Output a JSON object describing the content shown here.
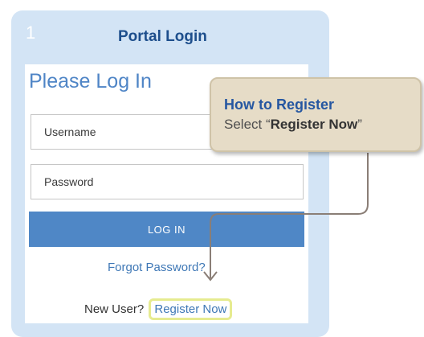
{
  "login_panel": {
    "step_number": "1",
    "title": "Portal Login",
    "heading": "Please Log In",
    "username_placeholder": "Username",
    "password_placeholder": "Password",
    "login_button_label": "LOG IN",
    "forgot_password_label": "Forgot Password?",
    "new_user_label": "New User?",
    "register_label": "Register Now"
  },
  "callout": {
    "title": "How to Register",
    "text_prefix": "Select “",
    "text_emphasis": "Register Now",
    "text_suffix": "”"
  },
  "colors": {
    "panel_bg": "#d3e4f5",
    "brand_blue": "#4f87c6",
    "title_blue": "#1d4e8c",
    "highlight": "#e6eb90",
    "callout_bg": "#e6dcc7",
    "connector": "#8a7e76"
  }
}
